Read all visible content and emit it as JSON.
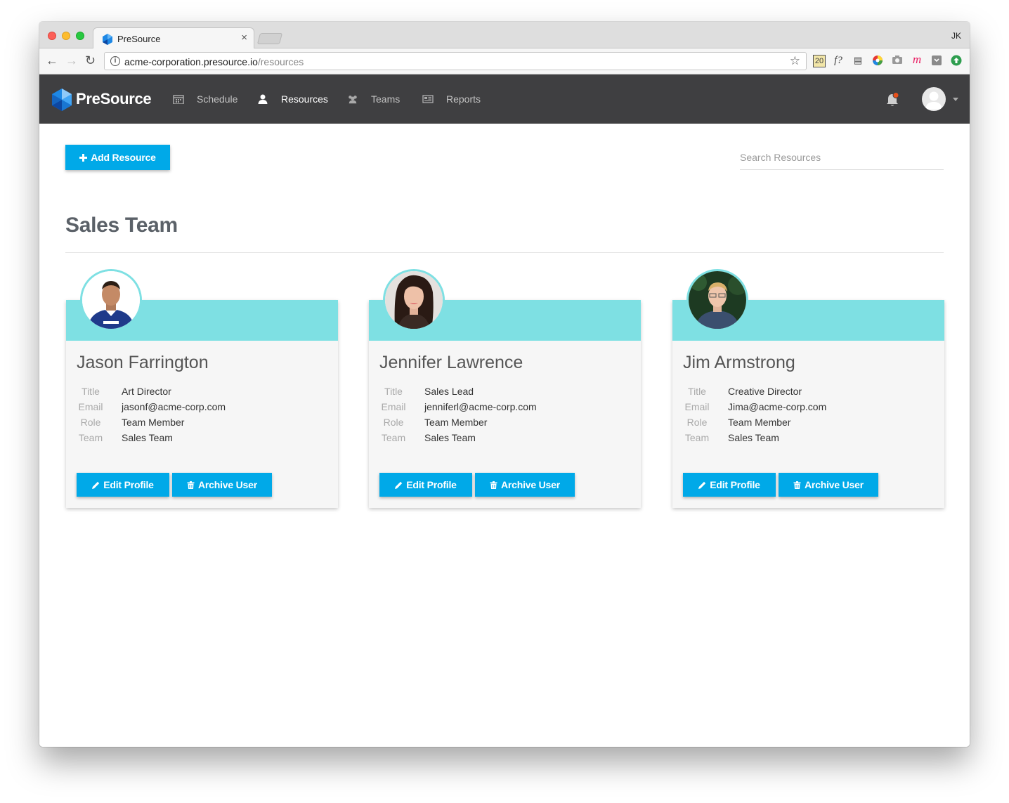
{
  "browser": {
    "tab_title": "PreSource",
    "tab_close": "×",
    "profile_initials": "JK",
    "url_host": "acme-corporation.presource.io",
    "url_path": "/resources",
    "nav": {
      "back": "←",
      "forward": "→",
      "reload": "↻"
    },
    "info_glyph": "i",
    "star": "☆",
    "extensions": [
      "20",
      "f?",
      "▤",
      "color-wheel-icon",
      "camera-icon",
      "m",
      "pocket-icon",
      "upload-icon"
    ]
  },
  "app": {
    "brand": "PreSource",
    "nav": [
      {
        "label": "Schedule",
        "icon": "calendar-icon"
      },
      {
        "label": "Resources",
        "icon": "user-icon",
        "active": true
      },
      {
        "label": "Teams",
        "icon": "users-icon"
      },
      {
        "label": "Reports",
        "icon": "newspaper-icon"
      }
    ],
    "colors": {
      "nav_bg": "#3f3f41",
      "accent": "#00a9e8",
      "band": "#7ee0e3",
      "notification": "#e8501a"
    }
  },
  "main": {
    "add_label": "Add Resource",
    "search_placeholder": "Search Resources",
    "section_title": "Sales Team",
    "field_labels": {
      "title": "Title",
      "email": "Email",
      "role": "Role",
      "team": "Team"
    },
    "edit_label": "Edit Profile",
    "archive_label": "Archive User",
    "cards": [
      {
        "name": "Jason Farrington",
        "title": "Art Director",
        "email": "jasonf@acme-corp.com",
        "role": "Team Member",
        "team": "Sales Team"
      },
      {
        "name": "Jennifer Lawrence",
        "title": "Sales Lead",
        "email": "jenniferl@acme-corp.com",
        "role": "Team Member",
        "team": "Sales Team"
      },
      {
        "name": "Jim Armstrong",
        "title": "Creative Director",
        "email": "Jima@acme-corp.com",
        "role": "Team Member",
        "team": "Sales Team"
      }
    ]
  }
}
